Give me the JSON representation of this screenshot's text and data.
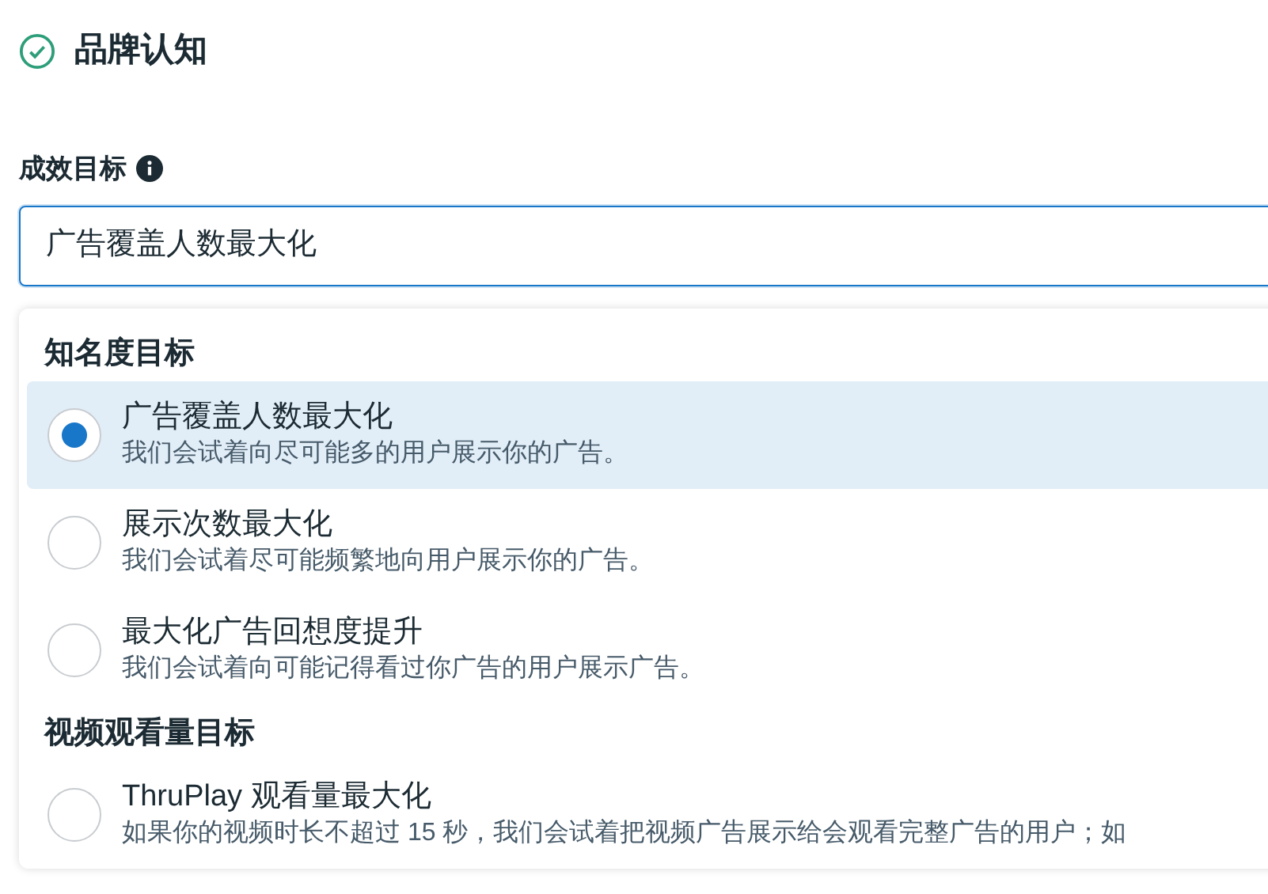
{
  "header": {
    "title": "品牌认知"
  },
  "goal_field": {
    "label": "成效目标",
    "value": "广告覆盖人数最大化"
  },
  "dropdown": {
    "sections": [
      {
        "heading": "知名度目标",
        "options": [
          {
            "title": "广告覆盖人数最大化",
            "description": "我们会试着向尽可能多的用户展示你的广告。",
            "selected": true
          },
          {
            "title": "展示次数最大化",
            "description": "我们会试着尽可能频繁地向用户展示你的广告。",
            "selected": false
          },
          {
            "title": "最大化广告回想度提升",
            "description": "我们会试着向可能记得看过你广告的用户展示广告。",
            "selected": false
          }
        ]
      },
      {
        "heading": "视频观看量目标",
        "options": [
          {
            "title": "ThruPlay 观看量最大化",
            "description": "如果你的视频时长不超过 15 秒，我们会试着把视频广告展示给会观看完整广告的用户；如",
            "selected": false
          }
        ]
      }
    ]
  }
}
